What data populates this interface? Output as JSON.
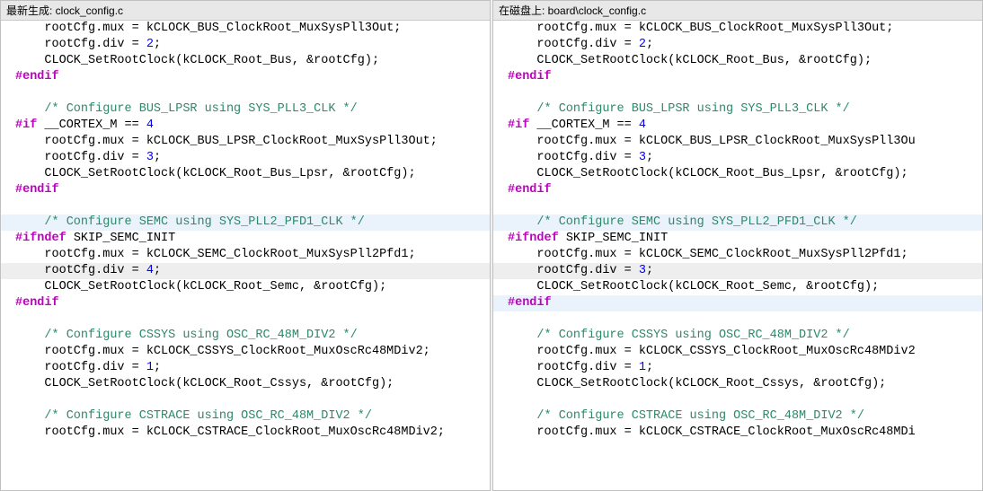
{
  "left": {
    "header_label": "最新生成: ",
    "header_path": "clock_config.c",
    "lines": [
      {
        "cls": "",
        "prefix": "    ",
        "tokens": [
          {
            "t": "plain",
            "v": "rootCfg.mux = kCLOCK_BUS_ClockRoot_MuxSysPll3Out;"
          }
        ]
      },
      {
        "cls": "",
        "prefix": "    ",
        "tokens": [
          {
            "t": "plain",
            "v": "rootCfg.div = "
          },
          {
            "t": "num",
            "v": "2"
          },
          {
            "t": "plain",
            "v": ";"
          }
        ]
      },
      {
        "cls": "",
        "prefix": "    ",
        "tokens": [
          {
            "t": "plain",
            "v": "CLOCK_SetRootClock(kCLOCK_Root_Bus, &rootCfg);"
          }
        ]
      },
      {
        "cls": "",
        "prefix": "",
        "tokens": [
          {
            "t": "pp",
            "v": "#endif"
          }
        ]
      },
      {
        "cls": "",
        "prefix": "",
        "tokens": [
          {
            "t": "plain",
            "v": ""
          }
        ]
      },
      {
        "cls": "",
        "prefix": "    ",
        "tokens": [
          {
            "t": "comment",
            "v": "/* Configure BUS_LPSR using SYS_PLL3_CLK */"
          }
        ]
      },
      {
        "cls": "",
        "prefix": "",
        "tokens": [
          {
            "t": "pp",
            "v": "#if"
          },
          {
            "t": "plain",
            "v": " __CORTEX_M == "
          },
          {
            "t": "num",
            "v": "4"
          }
        ]
      },
      {
        "cls": "",
        "prefix": "    ",
        "tokens": [
          {
            "t": "plain",
            "v": "rootCfg.mux = kCLOCK_BUS_LPSR_ClockRoot_MuxSysPll3Out;"
          }
        ]
      },
      {
        "cls": "",
        "prefix": "    ",
        "tokens": [
          {
            "t": "plain",
            "v": "rootCfg.div = "
          },
          {
            "t": "num",
            "v": "3"
          },
          {
            "t": "plain",
            "v": ";"
          }
        ]
      },
      {
        "cls": "",
        "prefix": "    ",
        "tokens": [
          {
            "t": "plain",
            "v": "CLOCK_SetRootClock(kCLOCK_Root_Bus_Lpsr, &rootCfg);"
          }
        ]
      },
      {
        "cls": "",
        "prefix": "",
        "tokens": [
          {
            "t": "pp",
            "v": "#endif"
          }
        ]
      },
      {
        "cls": "",
        "prefix": "",
        "tokens": [
          {
            "t": "plain",
            "v": ""
          }
        ]
      },
      {
        "cls": "hl-blue",
        "prefix": "    ",
        "tokens": [
          {
            "t": "comment",
            "v": "/* Configure SEMC using SYS_PLL2_PFD1_CLK */"
          }
        ]
      },
      {
        "cls": "",
        "prefix": "",
        "tokens": [
          {
            "t": "pp",
            "v": "#ifndef"
          },
          {
            "t": "plain",
            "v": " SKIP_SEMC_INIT"
          }
        ]
      },
      {
        "cls": "",
        "prefix": "    ",
        "tokens": [
          {
            "t": "plain",
            "v": "rootCfg.mux = kCLOCK_SEMC_ClockRoot_MuxSysPll2Pfd1;"
          }
        ]
      },
      {
        "cls": "hl-grey",
        "prefix": "    ",
        "tokens": [
          {
            "t": "plain",
            "v": "rootCfg.div = "
          },
          {
            "t": "num",
            "v": "4"
          },
          {
            "t": "plain",
            "v": ";"
          }
        ]
      },
      {
        "cls": "",
        "prefix": "    ",
        "tokens": [
          {
            "t": "plain",
            "v": "CLOCK_SetRootClock(kCLOCK_Root_Semc, &rootCfg);"
          }
        ]
      },
      {
        "cls": "",
        "prefix": "",
        "tokens": [
          {
            "t": "pp",
            "v": "#endif"
          }
        ]
      },
      {
        "cls": "",
        "prefix": "",
        "tokens": [
          {
            "t": "plain",
            "v": ""
          }
        ]
      },
      {
        "cls": "",
        "prefix": "    ",
        "tokens": [
          {
            "t": "comment",
            "v": "/* Configure CSSYS using OSC_RC_48M_DIV2 */"
          }
        ]
      },
      {
        "cls": "",
        "prefix": "    ",
        "tokens": [
          {
            "t": "plain",
            "v": "rootCfg.mux = kCLOCK_CSSYS_ClockRoot_MuxOscRc48MDiv2;"
          }
        ]
      },
      {
        "cls": "",
        "prefix": "    ",
        "tokens": [
          {
            "t": "plain",
            "v": "rootCfg.div = "
          },
          {
            "t": "num",
            "v": "1"
          },
          {
            "t": "plain",
            "v": ";"
          }
        ]
      },
      {
        "cls": "",
        "prefix": "    ",
        "tokens": [
          {
            "t": "plain",
            "v": "CLOCK_SetRootClock(kCLOCK_Root_Cssys, &rootCfg);"
          }
        ]
      },
      {
        "cls": "",
        "prefix": "",
        "tokens": [
          {
            "t": "plain",
            "v": ""
          }
        ]
      },
      {
        "cls": "",
        "prefix": "    ",
        "tokens": [
          {
            "t": "comment",
            "v": "/* Configure CSTRACE using OSC_RC_48M_DIV2 */"
          }
        ]
      },
      {
        "cls": "",
        "prefix": "    ",
        "tokens": [
          {
            "t": "plain",
            "v": "rootCfg.mux = kCLOCK_CSTRACE_ClockRoot_MuxOscRc48MDiv2;"
          }
        ]
      }
    ]
  },
  "right": {
    "header_label": "在磁盘上: ",
    "header_path": "board\\clock_config.c",
    "lines": [
      {
        "cls": "",
        "prefix": "    ",
        "tokens": [
          {
            "t": "plain",
            "v": "rootCfg.mux = kCLOCK_BUS_ClockRoot_MuxSysPll3Out;"
          }
        ]
      },
      {
        "cls": "",
        "prefix": "    ",
        "tokens": [
          {
            "t": "plain",
            "v": "rootCfg.div = "
          },
          {
            "t": "num",
            "v": "2"
          },
          {
            "t": "plain",
            "v": ";"
          }
        ]
      },
      {
        "cls": "",
        "prefix": "    ",
        "tokens": [
          {
            "t": "plain",
            "v": "CLOCK_SetRootClock(kCLOCK_Root_Bus, &rootCfg);"
          }
        ]
      },
      {
        "cls": "",
        "prefix": "",
        "tokens": [
          {
            "t": "pp",
            "v": "#endif"
          }
        ]
      },
      {
        "cls": "",
        "prefix": "",
        "tokens": [
          {
            "t": "plain",
            "v": ""
          }
        ]
      },
      {
        "cls": "",
        "prefix": "    ",
        "tokens": [
          {
            "t": "comment",
            "v": "/* Configure BUS_LPSR using SYS_PLL3_CLK */"
          }
        ]
      },
      {
        "cls": "",
        "prefix": "",
        "tokens": [
          {
            "t": "pp",
            "v": "#if"
          },
          {
            "t": "plain",
            "v": " __CORTEX_M == "
          },
          {
            "t": "num",
            "v": "4"
          }
        ]
      },
      {
        "cls": "",
        "prefix": "    ",
        "tokens": [
          {
            "t": "plain",
            "v": "rootCfg.mux = kCLOCK_BUS_LPSR_ClockRoot_MuxSysPll3Ou"
          }
        ]
      },
      {
        "cls": "",
        "prefix": "    ",
        "tokens": [
          {
            "t": "plain",
            "v": "rootCfg.div = "
          },
          {
            "t": "num",
            "v": "3"
          },
          {
            "t": "plain",
            "v": ";"
          }
        ]
      },
      {
        "cls": "",
        "prefix": "    ",
        "tokens": [
          {
            "t": "plain",
            "v": "CLOCK_SetRootClock(kCLOCK_Root_Bus_Lpsr, &rootCfg);"
          }
        ]
      },
      {
        "cls": "",
        "prefix": "",
        "tokens": [
          {
            "t": "pp",
            "v": "#endif"
          }
        ]
      },
      {
        "cls": "",
        "prefix": "",
        "tokens": [
          {
            "t": "plain",
            "v": ""
          }
        ]
      },
      {
        "cls": "hl-blue",
        "prefix": "    ",
        "tokens": [
          {
            "t": "comment",
            "v": "/* Configure SEMC using SYS_PLL2_PFD1_CLK */"
          }
        ]
      },
      {
        "cls": "",
        "prefix": "",
        "tokens": [
          {
            "t": "pp",
            "v": "#ifndef"
          },
          {
            "t": "plain",
            "v": " SKIP_SEMC_INIT"
          }
        ]
      },
      {
        "cls": "",
        "prefix": "    ",
        "tokens": [
          {
            "t": "plain",
            "v": "rootCfg.mux = kCLOCK_SEMC_ClockRoot_MuxSysPll2Pfd1;"
          }
        ]
      },
      {
        "cls": "hl-grey",
        "prefix": "    ",
        "tokens": [
          {
            "t": "plain",
            "v": "rootCfg.div = "
          },
          {
            "t": "num",
            "v": "3"
          },
          {
            "t": "plain",
            "v": ";"
          }
        ]
      },
      {
        "cls": "",
        "prefix": "    ",
        "tokens": [
          {
            "t": "plain",
            "v": "CLOCK_SetRootClock(kCLOCK_Root_Semc, &rootCfg);"
          }
        ]
      },
      {
        "cls": "hl-blue",
        "prefix": "",
        "tokens": [
          {
            "t": "pp",
            "v": "#endif"
          }
        ]
      },
      {
        "cls": "",
        "prefix": "",
        "tokens": [
          {
            "t": "plain",
            "v": ""
          }
        ]
      },
      {
        "cls": "",
        "prefix": "    ",
        "tokens": [
          {
            "t": "comment",
            "v": "/* Configure CSSYS using OSC_RC_48M_DIV2 */"
          }
        ]
      },
      {
        "cls": "",
        "prefix": "    ",
        "tokens": [
          {
            "t": "plain",
            "v": "rootCfg.mux = kCLOCK_CSSYS_ClockRoot_MuxOscRc48MDiv2"
          }
        ]
      },
      {
        "cls": "",
        "prefix": "    ",
        "tokens": [
          {
            "t": "plain",
            "v": "rootCfg.div = "
          },
          {
            "t": "num",
            "v": "1"
          },
          {
            "t": "plain",
            "v": ";"
          }
        ]
      },
      {
        "cls": "",
        "prefix": "    ",
        "tokens": [
          {
            "t": "plain",
            "v": "CLOCK_SetRootClock(kCLOCK_Root_Cssys, &rootCfg);"
          }
        ]
      },
      {
        "cls": "",
        "prefix": "",
        "tokens": [
          {
            "t": "plain",
            "v": ""
          }
        ]
      },
      {
        "cls": "",
        "prefix": "    ",
        "tokens": [
          {
            "t": "comment",
            "v": "/* Configure CSTRACE using OSC_RC_48M_DIV2 */"
          }
        ]
      },
      {
        "cls": "",
        "prefix": "    ",
        "tokens": [
          {
            "t": "plain",
            "v": "rootCfg.mux = kCLOCK_CSTRACE_ClockRoot_MuxOscRc48MDi"
          }
        ]
      }
    ]
  }
}
